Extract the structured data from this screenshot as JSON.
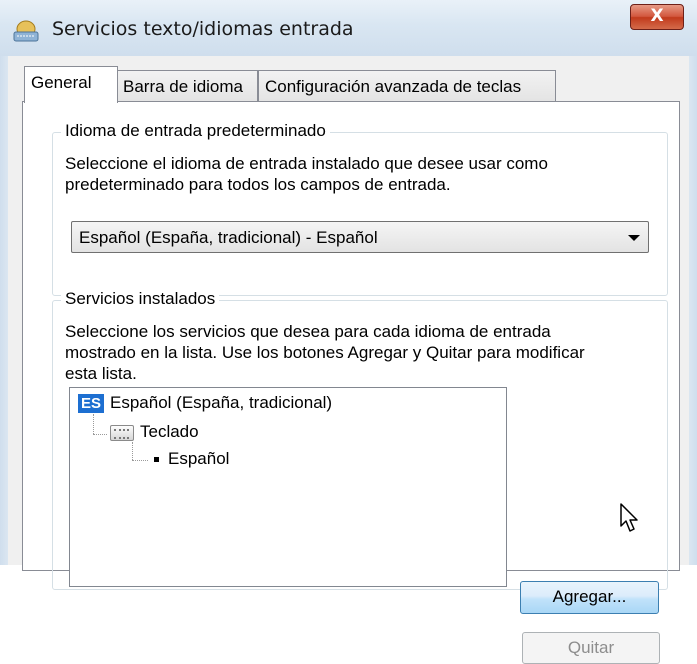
{
  "window": {
    "title": "Servicios texto/idiomas entrada",
    "close_label": "X",
    "icon": "keyboard-globe-icon"
  },
  "tabs": [
    {
      "label": "General",
      "active": true
    },
    {
      "label": "Barra de idioma",
      "active": false
    },
    {
      "label": "Configuración avanzada de teclas",
      "active": false
    }
  ],
  "default_input": {
    "title": "Idioma de entrada predeterminado",
    "description_line1": "Seleccione el idioma de entrada instalado que desee usar como",
    "description_line2": "predeterminado para todos los campos de entrada.",
    "selected": "Español (España, tradicional) - Español"
  },
  "installed": {
    "title": "Servicios instalados",
    "description_line1": "Seleccione los servicios que desea para cada idioma de entrada",
    "description_line2": "mostrado en la lista. Use los botones Agregar y Quitar para modificar",
    "description_line3": "esta lista.",
    "tree": {
      "language_badge": "ES",
      "language": "Español (España, tradicional)",
      "category": "Teclado",
      "keyboard": "Español"
    },
    "add_button": "Agregar...",
    "remove_button": "Quitar"
  },
  "colors": {
    "accent": "#1d6fd1",
    "close": "#c13a1c"
  }
}
